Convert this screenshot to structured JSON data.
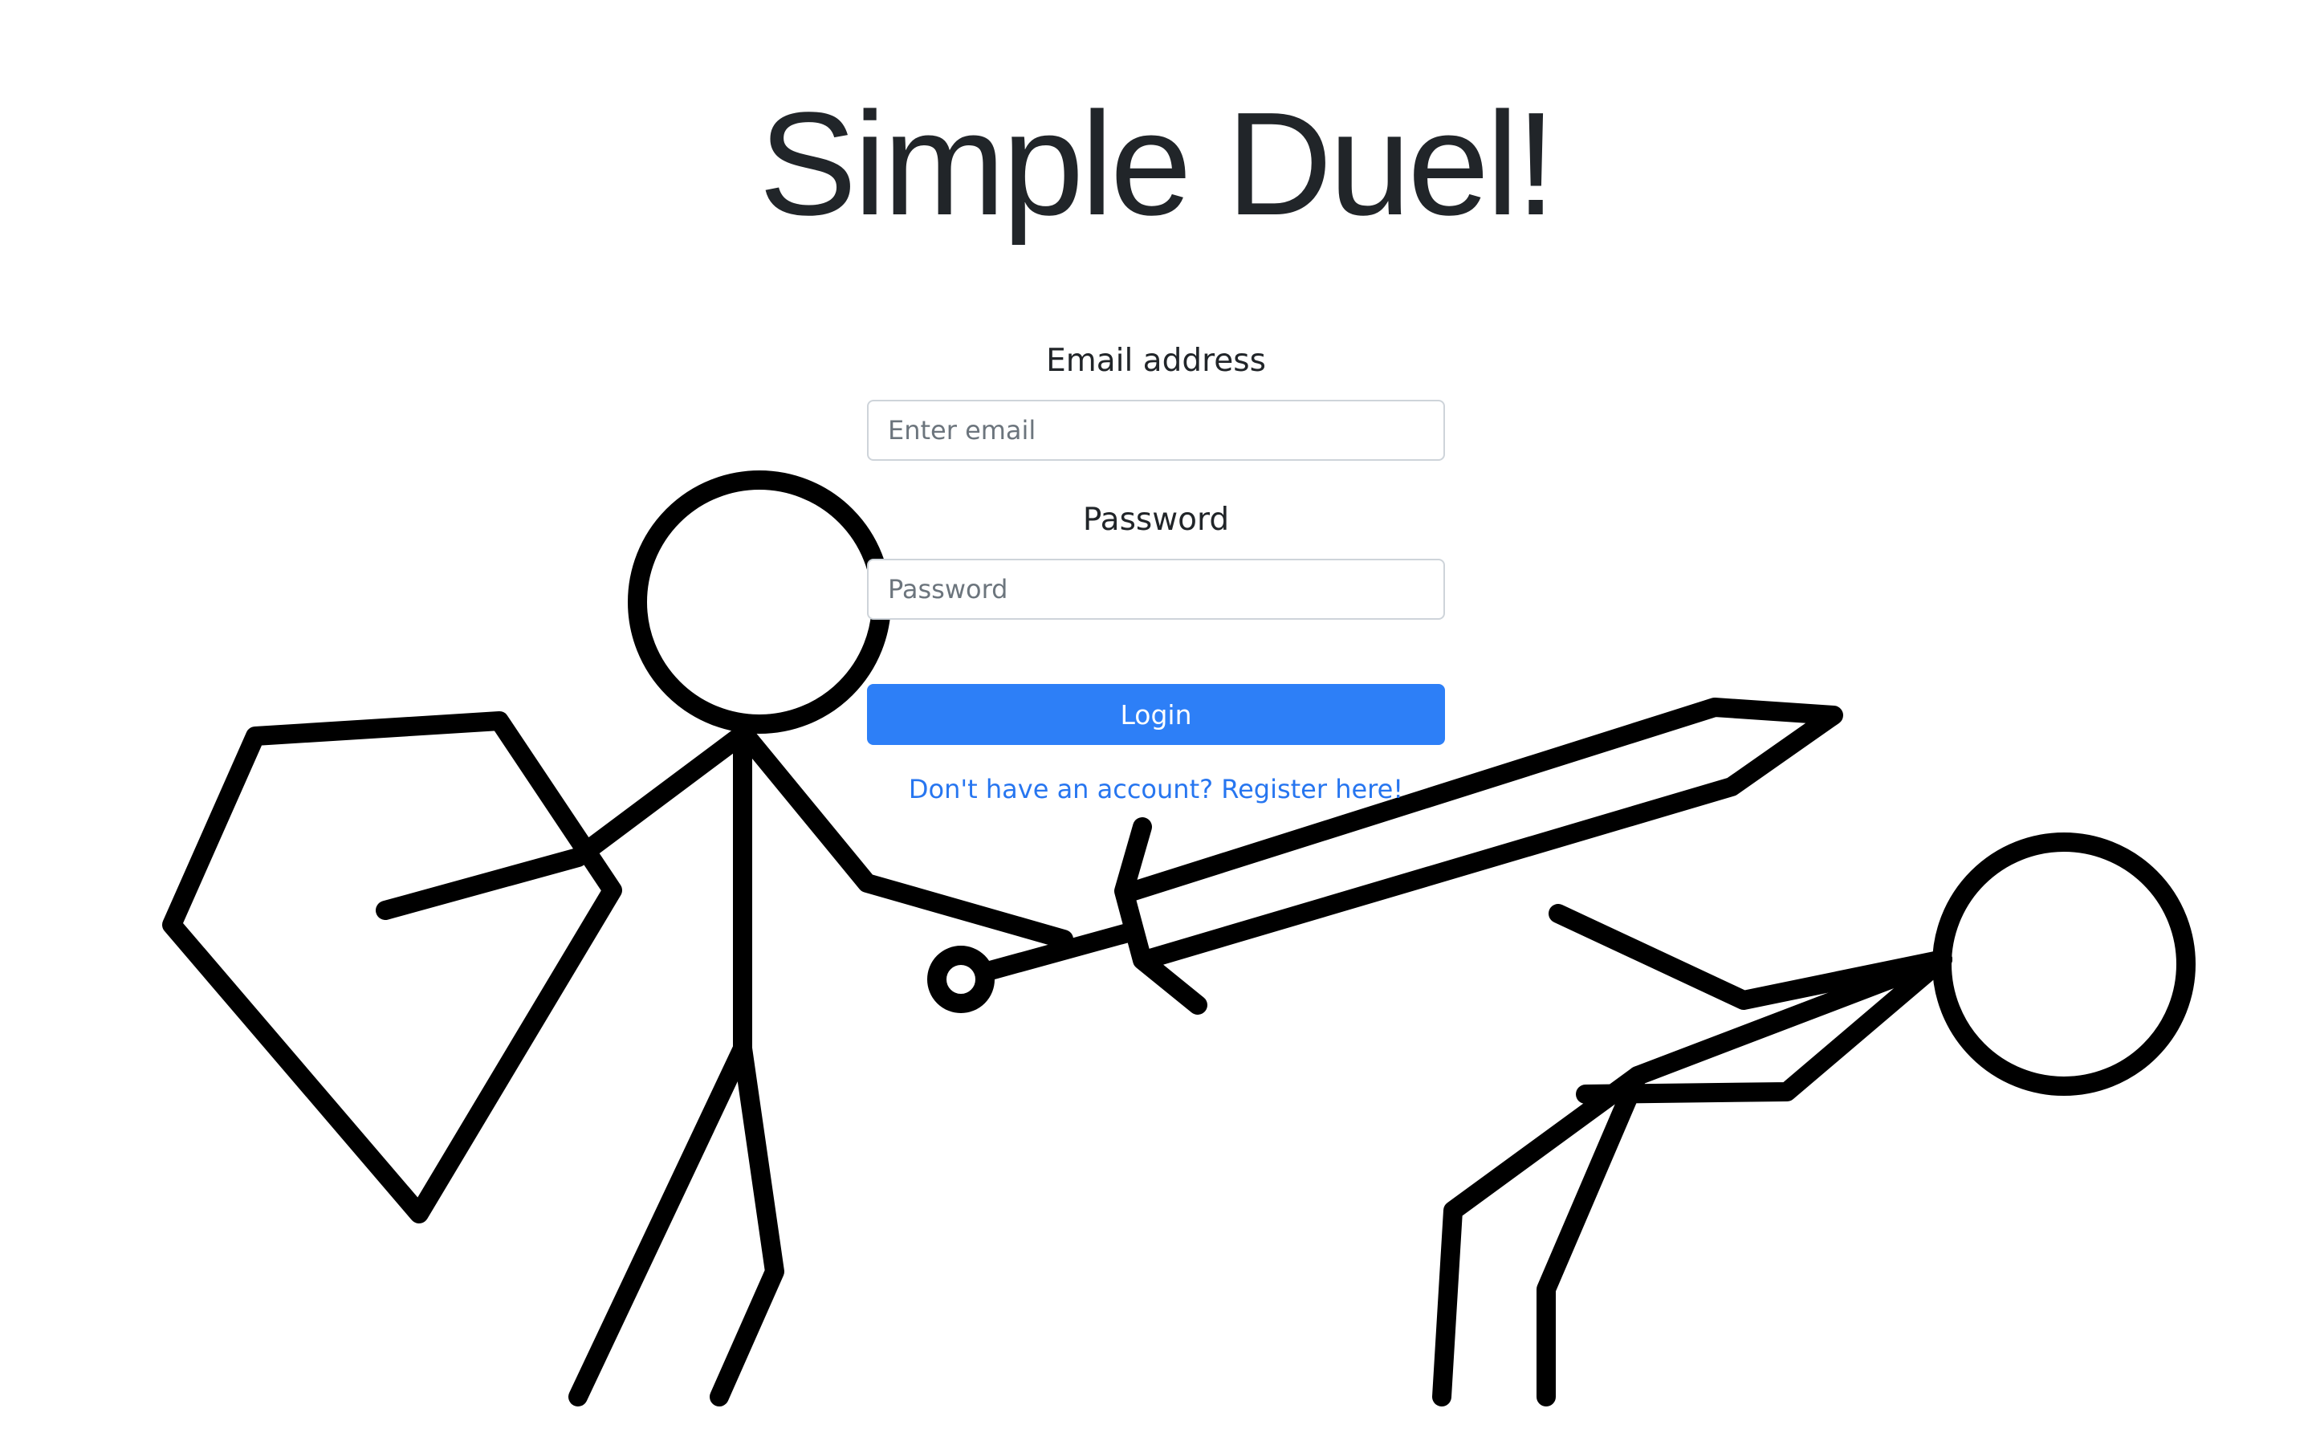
{
  "title": "Simple Duel!",
  "login_form": {
    "email": {
      "label": "Email address",
      "placeholder": "Enter email",
      "value": ""
    },
    "password": {
      "label": "Password",
      "placeholder": "Password",
      "value": ""
    },
    "submit_label": "Login",
    "register_link": "Don't have an account? Register here!"
  },
  "colors": {
    "button_background": "#2d7ff7",
    "link": "#2776f0",
    "title_text": "#212529",
    "drawing_ink": "#000000"
  }
}
